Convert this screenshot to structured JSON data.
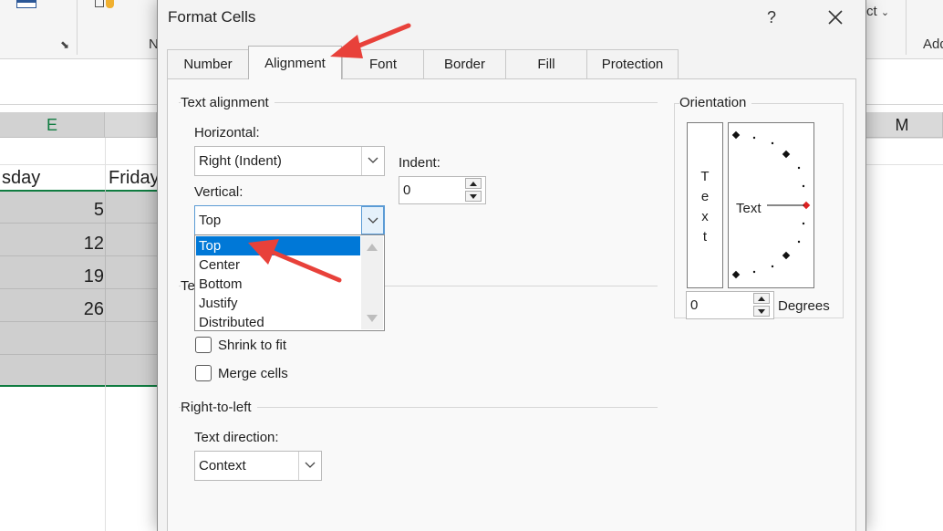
{
  "background": {
    "columns": {
      "e": "E",
      "m": "M"
    },
    "ribbon": {
      "group_label_partial": "N",
      "select_partial": "ct",
      "add_partial": "Add"
    },
    "headers": {
      "day1": "sday",
      "day2": "Friday"
    },
    "cells": [
      "5",
      "12",
      "19",
      "26"
    ]
  },
  "dialog": {
    "title": "Format Cells",
    "help_label": "?",
    "close_label": "✕",
    "tabs": [
      {
        "label": "Number",
        "active": false
      },
      {
        "label": "Alignment",
        "active": true
      },
      {
        "label": "Font",
        "active": false
      },
      {
        "label": "Border",
        "active": false
      },
      {
        "label": "Fill",
        "active": false
      },
      {
        "label": "Protection",
        "active": false
      }
    ],
    "text_alignment": {
      "group_label": "Text alignment",
      "horizontal_label": "Horizontal:",
      "horizontal_value": "Right (Indent)",
      "vertical_label": "Vertical:",
      "vertical_value": "Top",
      "indent_label": "Indent:",
      "indent_value": "0"
    },
    "vertical_options": [
      {
        "label": "Top",
        "selected": true
      },
      {
        "label": "Center",
        "selected": false
      },
      {
        "label": "Bottom",
        "selected": false
      },
      {
        "label": "Justify",
        "selected": false
      },
      {
        "label": "Distributed",
        "selected": false
      }
    ],
    "text_control": {
      "group_label_partial": "Te",
      "shrink_label": "Shrink to fit",
      "merge_label": "Merge cells"
    },
    "right_to_left": {
      "group_label": "Right-to-left",
      "direction_label": "Text direction:",
      "direction_value": "Context"
    },
    "orientation": {
      "group_label": "Orientation",
      "vertical_text_chars": [
        "T",
        "e",
        "x",
        "t"
      ],
      "dial_text": "Text",
      "degrees_value": "0",
      "degrees_label": "Degrees"
    }
  },
  "colors": {
    "selection_blue": "#0078d7",
    "annotation_red": "#e8413a",
    "excel_green": "#107c41"
  }
}
